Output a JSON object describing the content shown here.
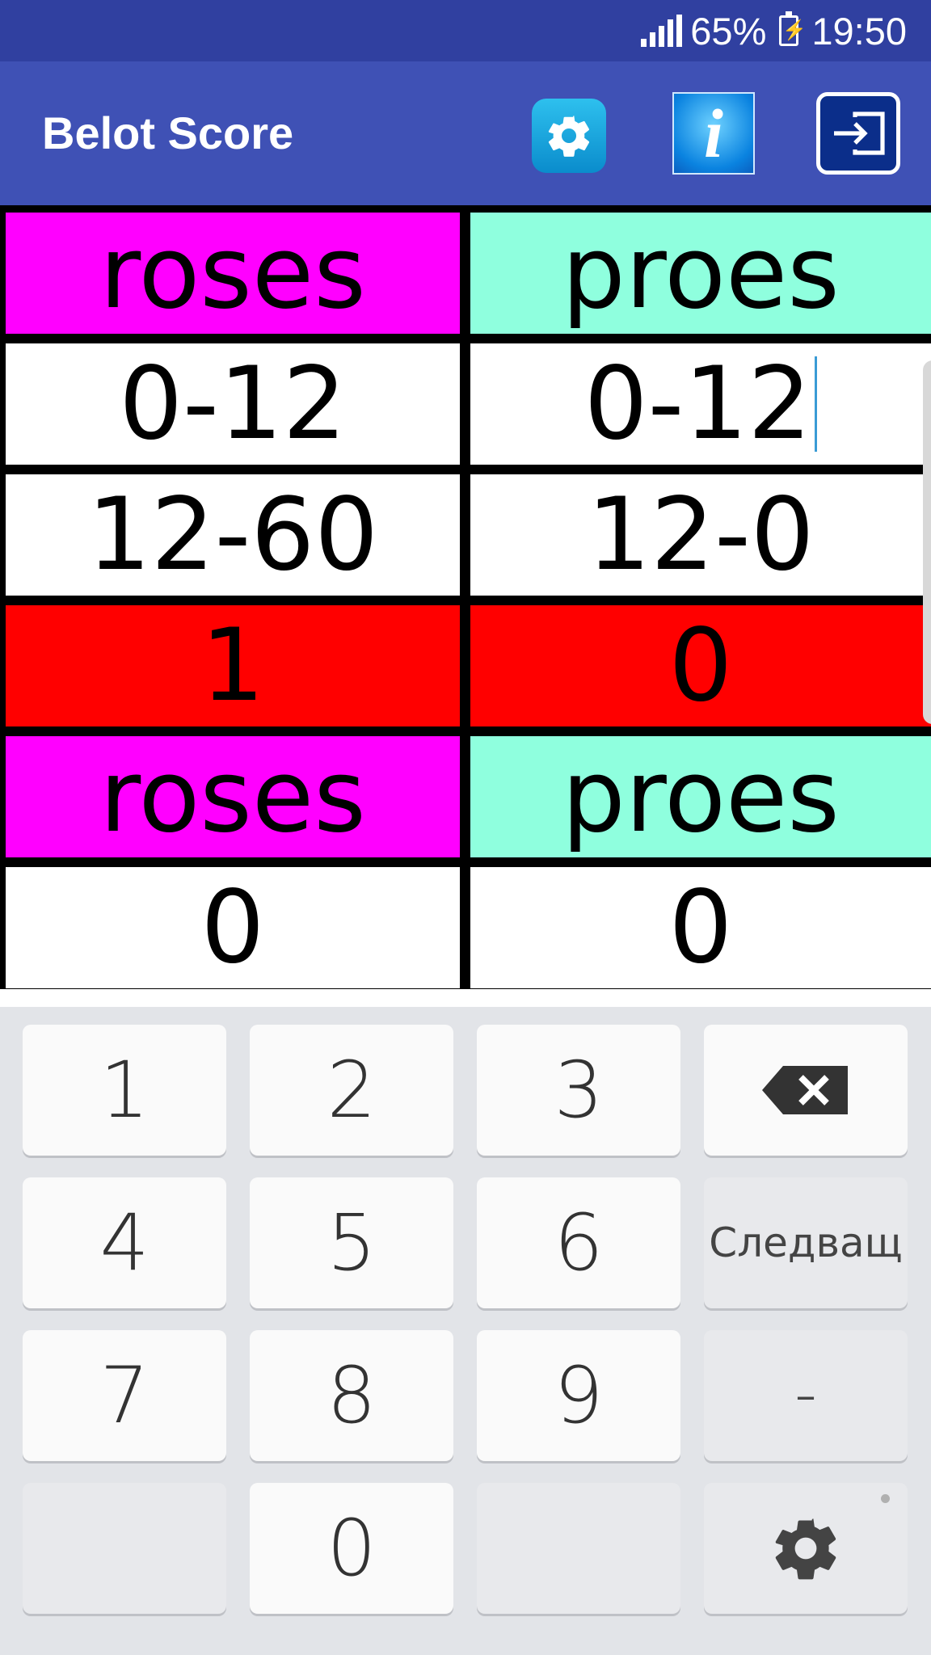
{
  "status_bar": {
    "battery_percent": "65%",
    "time": "19:50"
  },
  "app_bar": {
    "title": "Belot Score",
    "info_glyph": "i",
    "icons": [
      "settings-gear-icon",
      "info-icon",
      "exit-icon"
    ]
  },
  "score_table": {
    "rows": [
      [
        "roses",
        "proes"
      ],
      [
        "0-12",
        "0-12"
      ],
      [
        "12-60",
        "12-0"
      ],
      [
        "1",
        "0"
      ],
      [
        "roses",
        "proes"
      ],
      [
        "0",
        "0"
      ]
    ],
    "colors": {
      "team1_header": "#ff00ff",
      "team2_header": "#8fffde",
      "games_won_row": "#ff0000",
      "score_cell": "#ffffff"
    }
  },
  "keyboard": {
    "keys": {
      "k1": "1",
      "k2": "2",
      "k3": "3",
      "k4": "4",
      "k5": "5",
      "k6": "6",
      "k7": "7",
      "k8": "8",
      "k9": "9",
      "k0": "0",
      "next": "Следващ",
      "minus": "–"
    },
    "icons": [
      "backspace-icon",
      "keyboard-settings-icon"
    ]
  }
}
